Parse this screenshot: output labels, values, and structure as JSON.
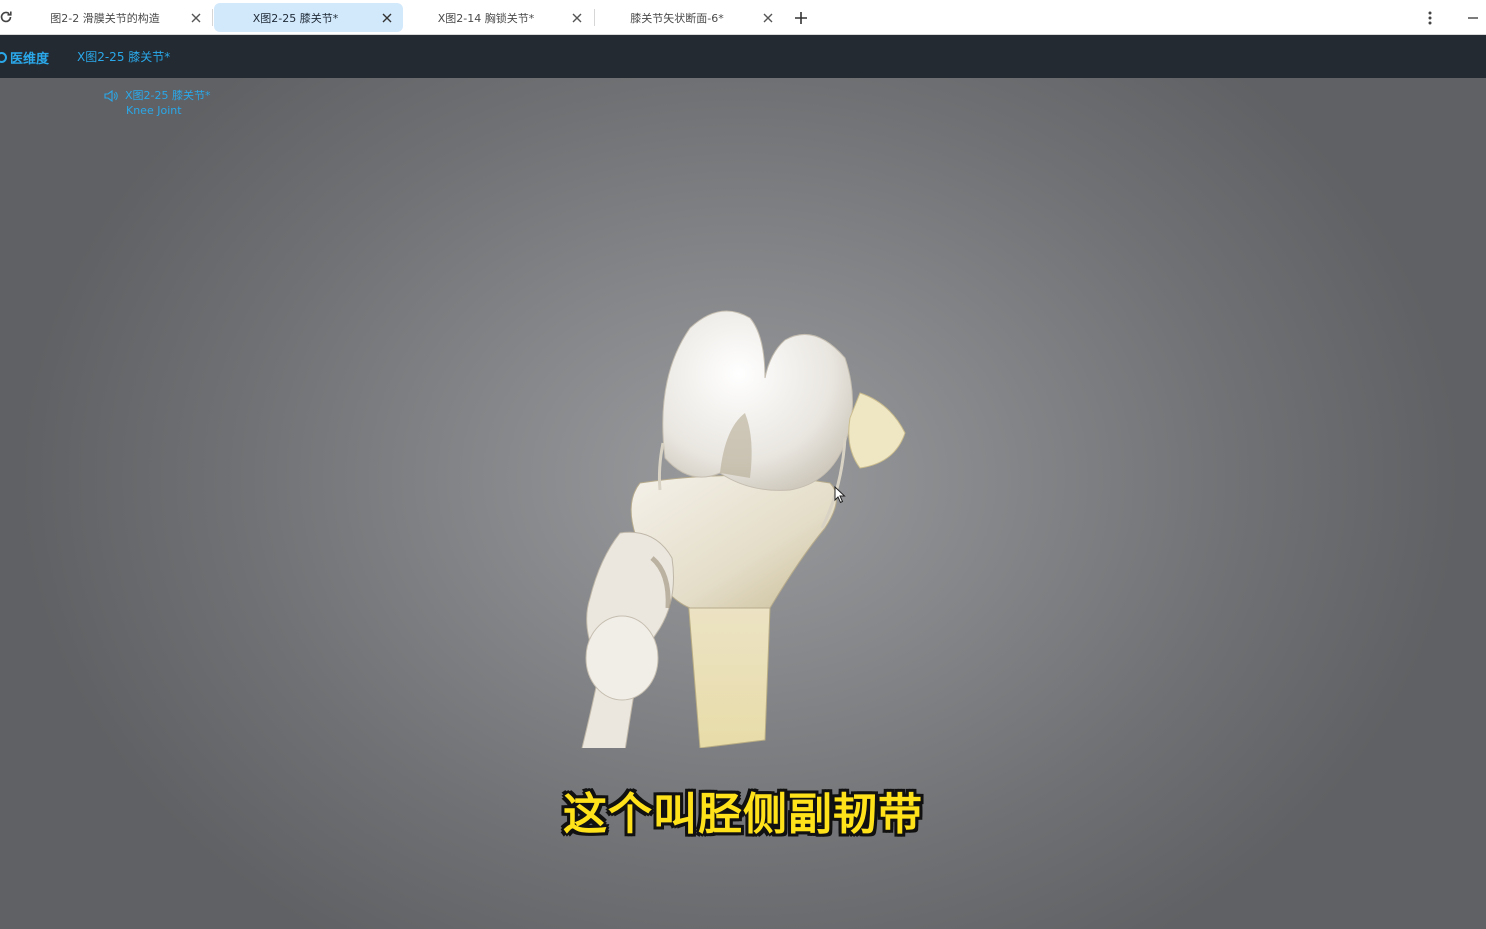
{
  "browser": {
    "tabs": [
      {
        "title": "图2-2 滑膜关节的构造",
        "active": false
      },
      {
        "title": "X图2-25 膝关节*",
        "active": true
      },
      {
        "title": "X图2-14 胸锁关节*",
        "active": false
      },
      {
        "title": "膝关节矢状断面-6*",
        "active": false
      }
    ],
    "icons": {
      "reload": "reload-icon",
      "close": "close-icon",
      "new_tab": "plus-icon",
      "menu": "more-vert-icon",
      "minimize": "minimize-icon"
    }
  },
  "app": {
    "brand": "医维度",
    "header_title": "X图2-25 膝关节*"
  },
  "viewport": {
    "model_title": "X图2-25 膝关节*",
    "model_subtitle": "Knee Joint",
    "subtitle_caption": "这个叫胫侧副韧带"
  },
  "colors": {
    "accent": "#2aa8ea",
    "header_bg": "#232a31",
    "active_tab_bg": "#d2e8fb",
    "caption_yellow": "#ffe21a"
  }
}
